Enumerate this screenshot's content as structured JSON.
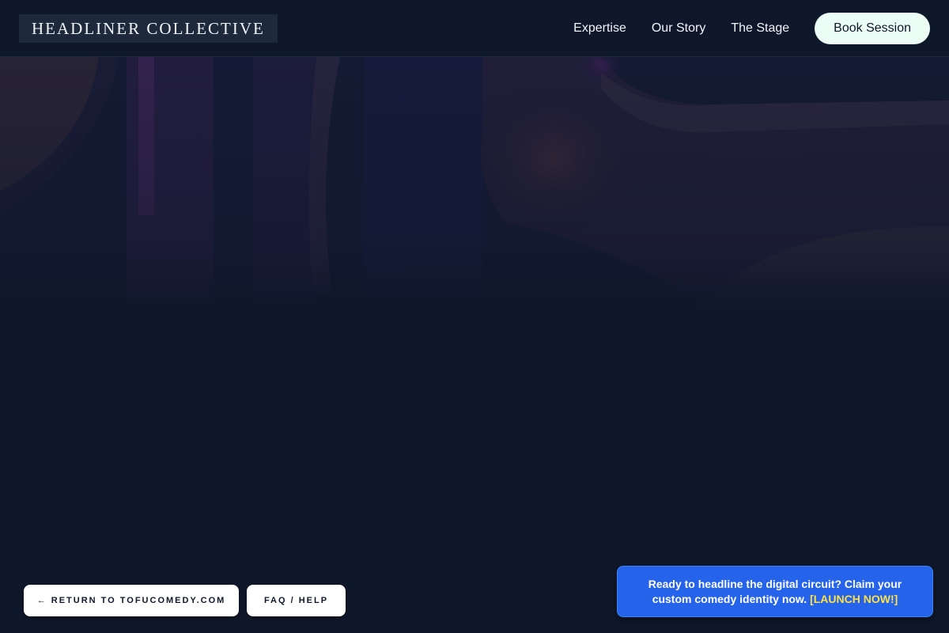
{
  "header": {
    "brand": "HEADLINER COLLECTIVE",
    "nav": {
      "expertise": "Expertise",
      "our_story": "Our Story",
      "the_stage": "The Stage"
    },
    "book_button": "Book Session"
  },
  "footer_actions": {
    "return_label": "← RETURN TO TOFUCOMEDY.COM",
    "faq_label": "FAQ / HELP"
  },
  "promo": {
    "text": "Ready to headline the digital circuit? Claim your custom comedy identity now.",
    "cta": "[LAUNCH NOW!]"
  },
  "colors": {
    "background": "#0f172a",
    "header_brand_bg": "#1e293b",
    "book_button_bg": "#ecfdf5",
    "promo_bg": "#2563eb",
    "promo_cta": "#fde047"
  },
  "icons": {
    "return": "left-arrow-icon"
  }
}
